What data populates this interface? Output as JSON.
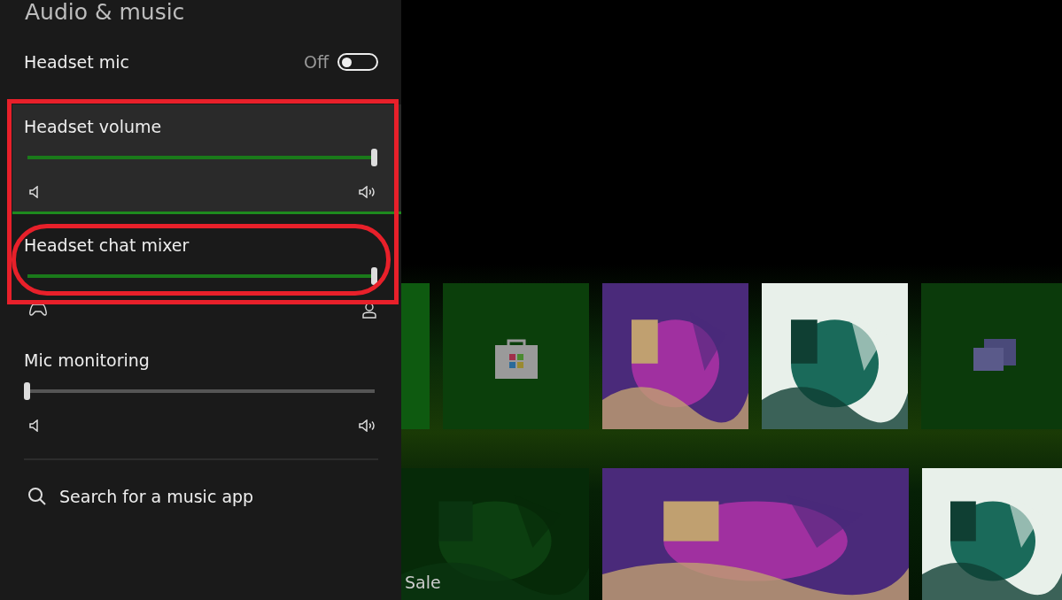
{
  "panel": {
    "title": "Audio & music",
    "toggle": {
      "label": "Headset mic",
      "state_text": "Off",
      "on": false
    },
    "sliders": [
      {
        "label": "Headset volume",
        "kind": "volume",
        "level": 1,
        "focused": true
      },
      {
        "label": "Headset chat mixer",
        "kind": "mix",
        "level": 1,
        "focused": false
      },
      {
        "label": "Mic monitoring",
        "kind": "volume",
        "level": 0,
        "focused": false
      }
    ],
    "search": {
      "label": "Search for a music app"
    }
  },
  "dashboard": {
    "top_tiles": [
      {
        "kind": "green"
      },
      {
        "kind": "store"
      },
      {
        "kind": "picture"
      },
      {
        "kind": "picture"
      },
      {
        "kind": "chat"
      }
    ],
    "bottom_tiles": [
      {
        "kind": "sale",
        "label": "Sale"
      },
      {
        "kind": "picture"
      },
      {
        "kind": "picture"
      }
    ]
  }
}
